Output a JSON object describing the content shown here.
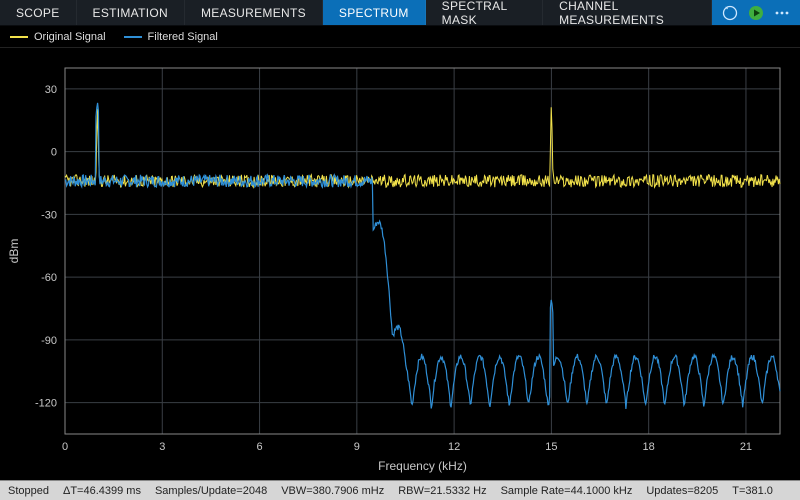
{
  "tabs": {
    "items": [
      {
        "label": "SCOPE"
      },
      {
        "label": "ESTIMATION"
      },
      {
        "label": "MEASUREMENTS"
      },
      {
        "label": "SPECTRUM"
      },
      {
        "label": "SPECTRAL MASK"
      },
      {
        "label": "CHANNEL MEASUREMENTS"
      }
    ],
    "selected_index": 3
  },
  "legend": {
    "items": [
      {
        "label": "Original Signal",
        "color": "#f2e24b"
      },
      {
        "label": "Filtered Signal",
        "color": "#2f8fd6"
      }
    ]
  },
  "chart_data": {
    "type": "line",
    "xlabel": "Frequency (kHz)",
    "ylabel": "dBm",
    "xlim": [
      0,
      22.05
    ],
    "ylim": [
      -135,
      40
    ],
    "xticks": [
      0,
      3,
      6,
      9,
      12,
      15,
      18,
      21
    ],
    "yticks": [
      -120,
      -90,
      -60,
      -30,
      0,
      30
    ],
    "grid": true,
    "noise_floor_original_dbm": -14,
    "noise_amplitude_dbm": 3,
    "series": [
      {
        "name": "Original Signal",
        "color": "#f2e24b",
        "baseline_dbm": -14,
        "peaks": [
          {
            "freq_khz": 1.0,
            "level_dbm": 24
          },
          {
            "freq_khz": 15.0,
            "level_dbm": 26
          }
        ]
      },
      {
        "name": "Filtered Signal",
        "color": "#2f8fd6",
        "passband_end_khz": 9.5,
        "passband_level_dbm": -14,
        "stopband_level_dbm": -98,
        "stopband_ripple_depth_dbm": 24,
        "stopband_lobe_spacing_khz": 0.6,
        "peaks": [
          {
            "freq_khz": 1.0,
            "level_dbm": 24
          },
          {
            "freq_khz": 15.0,
            "level_dbm": -70
          }
        ]
      }
    ]
  },
  "status": {
    "state": "Stopped",
    "delta_t": "ΔT=46.4399 ms",
    "samples_per_update": "Samples/Update=2048",
    "vbw": "VBW=380.7906 mHz",
    "rbw": "RBW=21.5332 Hz",
    "sample_rate": "Sample Rate=44.1000 kHz",
    "updates": "Updates=8205",
    "time": "T=381.0"
  },
  "icons": {
    "rewind": "rewind-icon",
    "play": "play-icon",
    "more": "more-icon"
  }
}
